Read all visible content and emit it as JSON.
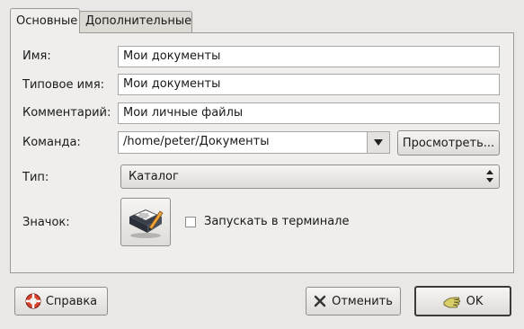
{
  "tabs": [
    {
      "label": "Основные",
      "active": true
    },
    {
      "label": "Дополнительные",
      "active": false
    }
  ],
  "fields": {
    "name": {
      "label": "Имя:",
      "value": "Мои документы"
    },
    "generic_name": {
      "label": "Типовое имя:",
      "value": "Мои документы"
    },
    "comment": {
      "label": "Комментарий:",
      "value": "Мои личные файлы"
    },
    "command": {
      "label": "Команда:",
      "value": "/home/peter/Документы",
      "browse_label": "Просмотреть..."
    },
    "type": {
      "label": "Тип:",
      "value": "Каталог"
    },
    "icon": {
      "label": "Значок:"
    },
    "terminal": {
      "label": "Запускать в терминале",
      "checked": false
    }
  },
  "buttons": {
    "help": "Справка",
    "cancel": "Отменить",
    "ok": "OK"
  },
  "icons": {
    "icon_preview": "folder-document-pencil-icon",
    "help": "lifebuoy-icon",
    "cancel": "cancel-x-icon",
    "ok": "ok-hand-icon"
  }
}
